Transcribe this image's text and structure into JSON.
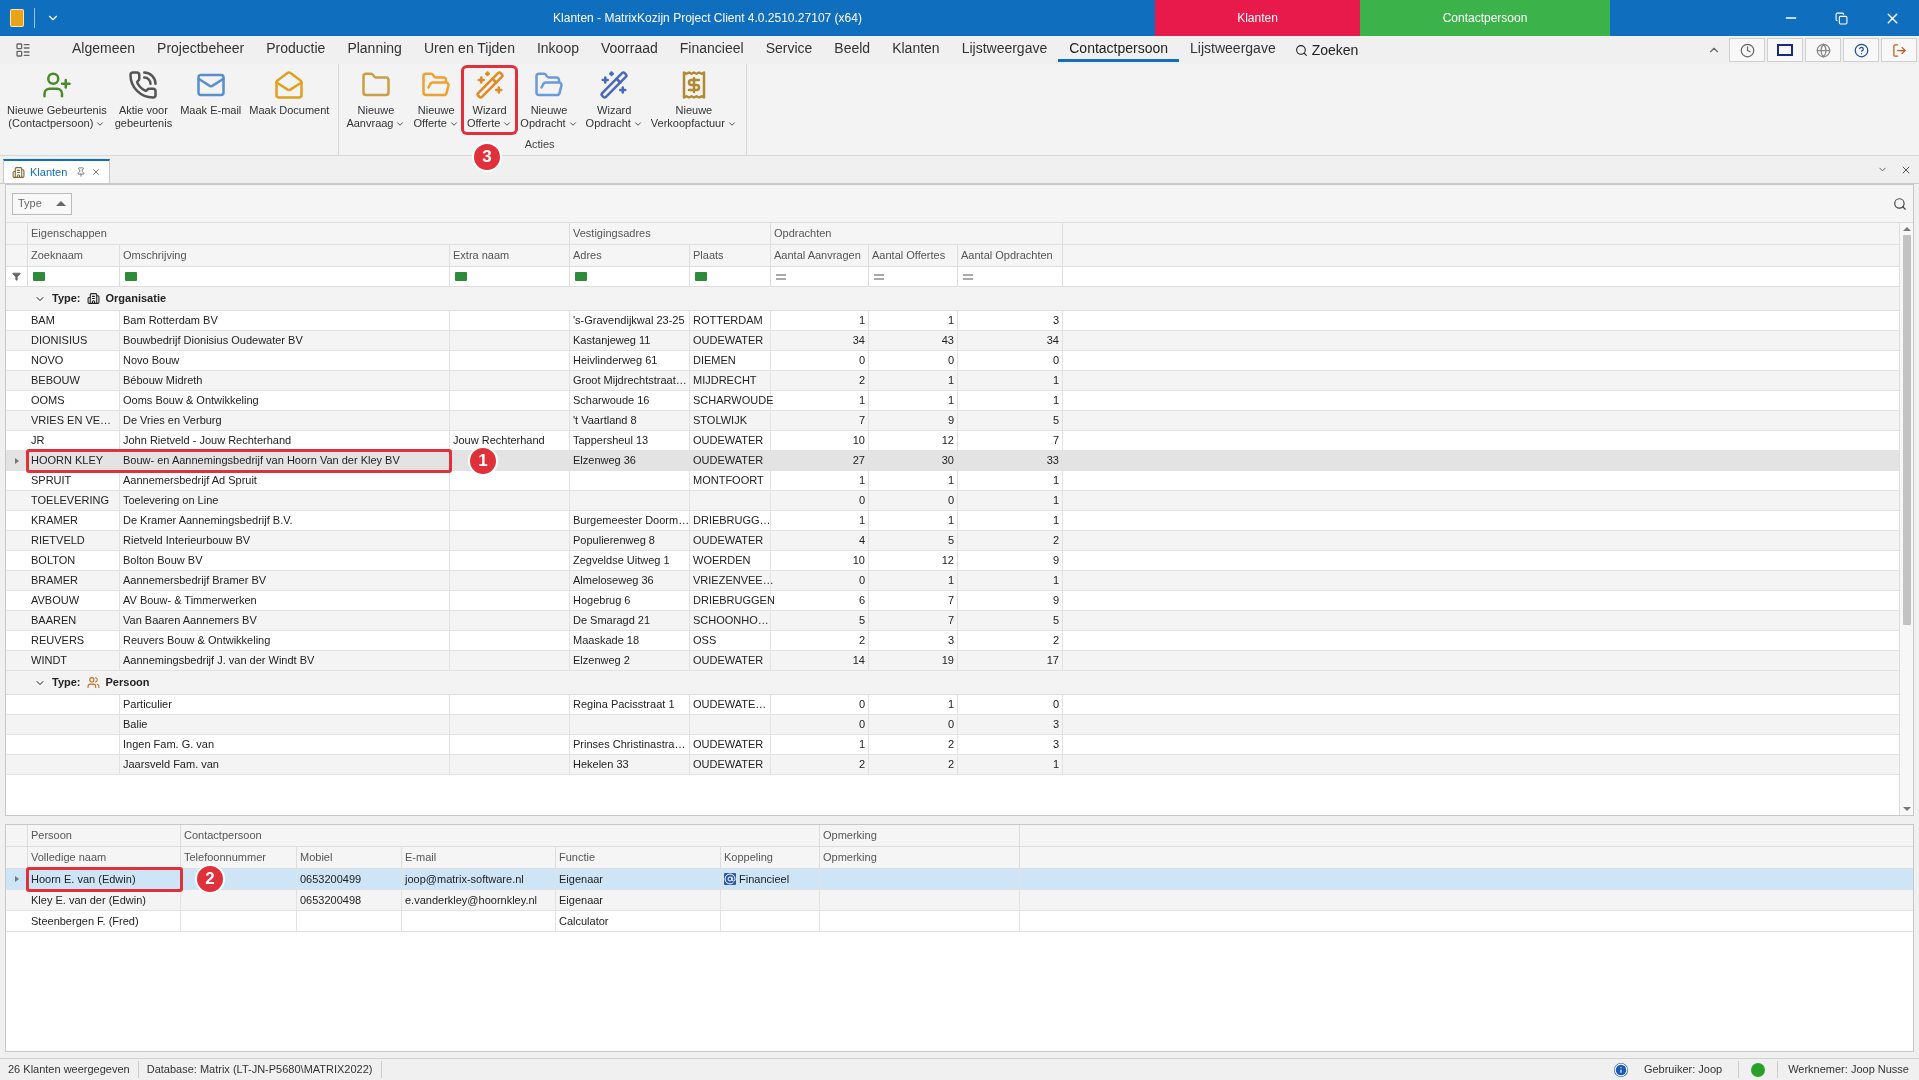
{
  "window": {
    "title": "Klanten - MatrixKozijn Project Client 4.0.2510.27107 (x64)",
    "context_tabs": [
      {
        "label": "Klanten",
        "color": "#e8194b"
      },
      {
        "label": "Contactpersoon",
        "color": "#3cb34a"
      }
    ]
  },
  "menu": [
    {
      "label": "Algemeen",
      "selected": false
    },
    {
      "label": "Projectbeheer",
      "selected": false
    },
    {
      "label": "Productie",
      "selected": false
    },
    {
      "label": "Planning",
      "selected": false
    },
    {
      "label": "Uren en Tijden",
      "selected": false
    },
    {
      "label": "Inkoop",
      "selected": false
    },
    {
      "label": "Voorraad",
      "selected": false
    },
    {
      "label": "Financieel",
      "selected": false
    },
    {
      "label": "Service",
      "selected": false
    },
    {
      "label": "Beeld",
      "selected": false
    },
    {
      "label": "Klanten",
      "selected": false
    },
    {
      "label": "Lijstweergave",
      "selected": false
    },
    {
      "label": "Contactpersoon",
      "selected": true
    },
    {
      "label": "Lijstweergave",
      "selected": false
    }
  ],
  "search": {
    "label": "Zoeken"
  },
  "ribbon": [
    {
      "buttons": [
        {
          "lines": [
            "Nieuwe Gebeurtenis",
            "(Contactpersoon)"
          ],
          "dropdown": true
        },
        {
          "lines": [
            "Aktie voor",
            "gebeurtenis"
          ],
          "dropdown": false
        },
        {
          "lines": [
            "Maak E-mail"
          ],
          "dropdown": false
        },
        {
          "lines": [
            "Maak Document"
          ],
          "dropdown": false
        }
      ]
    },
    {
      "label": "Acties",
      "buttons": [
        {
          "lines": [
            "Nieuwe",
            "Aanvraag"
          ],
          "dropdown": true
        },
        {
          "lines": [
            "Nieuwe",
            "Offerte"
          ],
          "dropdown": true
        },
        {
          "lines": [
            "Wizard",
            "Offerte"
          ],
          "dropdown": true,
          "callout": "3"
        },
        {
          "lines": [
            "Nieuwe",
            "Opdracht"
          ],
          "dropdown": true
        },
        {
          "lines": [
            "Wizard",
            "Opdracht"
          ],
          "dropdown": true
        },
        {
          "lines": [
            "Nieuwe",
            "Verkoopfactuur"
          ],
          "dropdown": true
        }
      ]
    }
  ],
  "document_tab": {
    "label": "Klanten"
  },
  "group_by": {
    "label": "Type"
  },
  "grid": {
    "bands": [
      {
        "label": "Eigenschappen"
      },
      {
        "label": "Vestigingsadres"
      },
      {
        "label": "Opdrachten"
      }
    ],
    "columns": [
      {
        "label": "Zoeknaam",
        "kind": "text"
      },
      {
        "label": "Omschrijving",
        "kind": "text"
      },
      {
        "label": "Extra naam",
        "kind": "text"
      },
      {
        "label": "Adres",
        "kind": "text"
      },
      {
        "label": "Plaats",
        "kind": "text"
      },
      {
        "label": "Aantal Aanvragen",
        "kind": "number"
      },
      {
        "label": "Aantal Offertes",
        "kind": "number"
      },
      {
        "label": "Aantal Opdrachten",
        "kind": "number"
      }
    ],
    "groups": [
      {
        "label": "Type:",
        "value": "Organisatie",
        "expanded": true,
        "rows": [
          {
            "zoeknaam": "BAM",
            "omschrijving": "Bam Rotterdam BV",
            "adres": "'s-Gravendijkwal 23-25",
            "plaats": "ROTTERDAM",
            "aanvragen": "1",
            "offertes": "1",
            "opdrachten": "3",
            "selected": false
          },
          {
            "zoeknaam": "DIONISIUS",
            "omschrijving": "Bouwbedrijf Dionisius Oudewater BV",
            "adres": "Kastanjeweg 11",
            "plaats": "OUDEWATER",
            "aanvragen": "34",
            "offertes": "43",
            "opdrachten": "34",
            "selected": false
          },
          {
            "zoeknaam": "NOVO",
            "omschrijving": "Novo Bouw",
            "adres": "Heivlinderweg 61",
            "plaats": "DIEMEN",
            "aanvragen": "0",
            "offertes": "0",
            "opdrachten": "0",
            "selected": false
          },
          {
            "zoeknaam": "BEBOUW",
            "omschrijving": "Bébouw Midreth",
            "adres": "Groot Mijdrechtstraat…",
            "plaats": "MIJDRECHT",
            "aanvragen": "2",
            "offertes": "1",
            "opdrachten": "1",
            "selected": false
          },
          {
            "zoeknaam": "OOMS",
            "omschrijving": "Ooms Bouw & Ontwikkeling",
            "adres": "Scharwoude 16",
            "plaats": "SCHARWOUDE",
            "aanvragen": "1",
            "offertes": "1",
            "opdrachten": "1",
            "selected": false
          },
          {
            "zoeknaam": "VRIES EN VE…",
            "omschrijving": "De Vries en Verburg",
            "adres": "'t Vaartland 8",
            "plaats": "STOLWIJK",
            "aanvragen": "7",
            "offertes": "9",
            "opdrachten": "5",
            "selected": false
          },
          {
            "zoeknaam": "JR",
            "omschrijving": "John Rietveld - Jouw Rechterhand",
            "extra_naam": "Jouw Rechterhand",
            "adres": "Tappersheul 13",
            "plaats": "OUDEWATER",
            "aanvragen": "10",
            "offertes": "12",
            "opdrachten": "7",
            "selected": false
          },
          {
            "zoeknaam": "HOORN KLEY",
            "omschrijving": "Bouw- en Aannemingsbedrijf van Hoorn Van der Kley BV",
            "adres": "Elzenweg 36",
            "plaats": "OUDEWATER",
            "aanvragen": "27",
            "offertes": "30",
            "opdrachten": "33",
            "selected": true,
            "callout": "1"
          },
          {
            "zoeknaam": "SPRUIT",
            "omschrijving": "Aannemersbedrijf Ad Spruit",
            "plaats": "MONTFOORT",
            "aanvragen": "1",
            "offertes": "1",
            "opdrachten": "1",
            "selected": false
          },
          {
            "zoeknaam": "TOELEVERING",
            "omschrijving": "Toelevering on Line",
            "aanvragen": "0",
            "offertes": "0",
            "opdrachten": "1",
            "selected": false
          },
          {
            "zoeknaam": "KRAMER",
            "omschrijving": "De Kramer Aannemingsbedrijf B.V.",
            "adres": "Burgemeester Doorm…",
            "plaats": "DRIEBRUGG…",
            "aanvragen": "1",
            "offertes": "1",
            "opdrachten": "1",
            "selected": false
          },
          {
            "zoeknaam": "RIETVELD",
            "omschrijving": "Rietveld Interieurbouw BV",
            "adres": "Populierenweg 8",
            "plaats": "OUDEWATER",
            "aanvragen": "4",
            "offertes": "5",
            "opdrachten": "2",
            "selected": false
          },
          {
            "zoeknaam": "BOLTON",
            "omschrijving": "Bolton Bouw BV",
            "adres": "Zegveldse Uitweg 1",
            "plaats": "WOERDEN",
            "aanvragen": "10",
            "offertes": "12",
            "opdrachten": "9",
            "selected": false
          },
          {
            "zoeknaam": "BRAMER",
            "omschrijving": "Aannemersbedrijf Bramer BV",
            "adres": "Almeloseweg 36",
            "plaats": "VRIEZENVEE…",
            "aanvragen": "0",
            "offertes": "1",
            "opdrachten": "1",
            "selected": false
          },
          {
            "zoeknaam": "AVBOUW",
            "omschrijving": "AV Bouw- & Timmerwerken",
            "adres": "Hogebrug 6",
            "plaats": "DRIEBRUGGEN",
            "aanvragen": "6",
            "offertes": "7",
            "opdrachten": "9",
            "selected": false
          },
          {
            "zoeknaam": "BAAREN",
            "omschrijving": "Van Baaren Aannemers BV",
            "adres": "De Smaragd 21",
            "plaats": "SCHOONHO…",
            "aanvragen": "5",
            "offertes": "7",
            "opdrachten": "5",
            "selected": false
          },
          {
            "zoeknaam": "REUVERS",
            "omschrijving": "Reuvers Bouw & Ontwikkeling",
            "adres": "Maaskade 18",
            "plaats": "OSS",
            "aanvragen": "2",
            "offertes": "3",
            "opdrachten": "2",
            "selected": false
          },
          {
            "zoeknaam": "WINDT",
            "omschrijving": "Aannemingsbedrijf J. van der Windt BV",
            "adres": "Elzenweg 2",
            "plaats": "OUDEWATER",
            "aanvragen": "14",
            "offertes": "19",
            "opdrachten": "17",
            "selected": false
          }
        ]
      },
      {
        "label": "Type:",
        "value": "Persoon",
        "expanded": true,
        "rows": [
          {
            "omschrijving": "Particulier",
            "adres": "Regina Pacisstraat 1",
            "plaats": "OUDEWATE…",
            "aanvragen": "0",
            "offertes": "1",
            "opdrachten": "0",
            "selected": false
          },
          {
            "omschrijving": "Balie",
            "aanvragen": "0",
            "offertes": "0",
            "opdrachten": "3",
            "selected": false
          },
          {
            "omschrijving": "Ingen Fam. G. van",
            "adres": "Prinses Christinastra…",
            "plaats": "OUDEWATER",
            "aanvragen": "1",
            "offertes": "2",
            "opdrachten": "3",
            "selected": false
          },
          {
            "omschrijving": "Jaarsveld Fam. van",
            "adres": "Hekelen 33",
            "plaats": "OUDEWATER",
            "aanvragen": "2",
            "offertes": "2",
            "opdrachten": "1",
            "selected": false
          }
        ]
      }
    ]
  },
  "contacts": {
    "bands": [
      {
        "label": "Persoon"
      },
      {
        "label": "Contactpersoon"
      },
      {
        "label": "Opmerking"
      }
    ],
    "columns": [
      {
        "label": "Volledige naam"
      },
      {
        "label": "Telefoonnummer"
      },
      {
        "label": "Mobiel"
      },
      {
        "label": "E-mail"
      },
      {
        "label": "Functie"
      },
      {
        "label": "Koppeling"
      },
      {
        "label": "Opmerking"
      }
    ],
    "rows": [
      {
        "naam": "Hoorn E. van (Edwin)",
        "mobiel": "0653200499",
        "email": "joop@matrix-software.nl",
        "functie": "Eigenaar",
        "koppeling": "Financieel",
        "selected": true,
        "callout": "2"
      },
      {
        "naam": "Kley E. van der (Edwin)",
        "mobiel": "0653200498",
        "email": "e.vanderkley@hoornkley.nl",
        "functie": "Eigenaar",
        "selected": false
      },
      {
        "naam": "Steenbergen F. (Fred)",
        "functie": "Calculator",
        "selected": false
      }
    ]
  },
  "status_bar": {
    "left": [
      "26 Klanten weergegeven",
      "Database: Matrix (LT-JN-P5680\\MATRIX2022)"
    ],
    "user": "Gebruiker: Joop",
    "employee": "Werknemer: Joop Nusse"
  }
}
